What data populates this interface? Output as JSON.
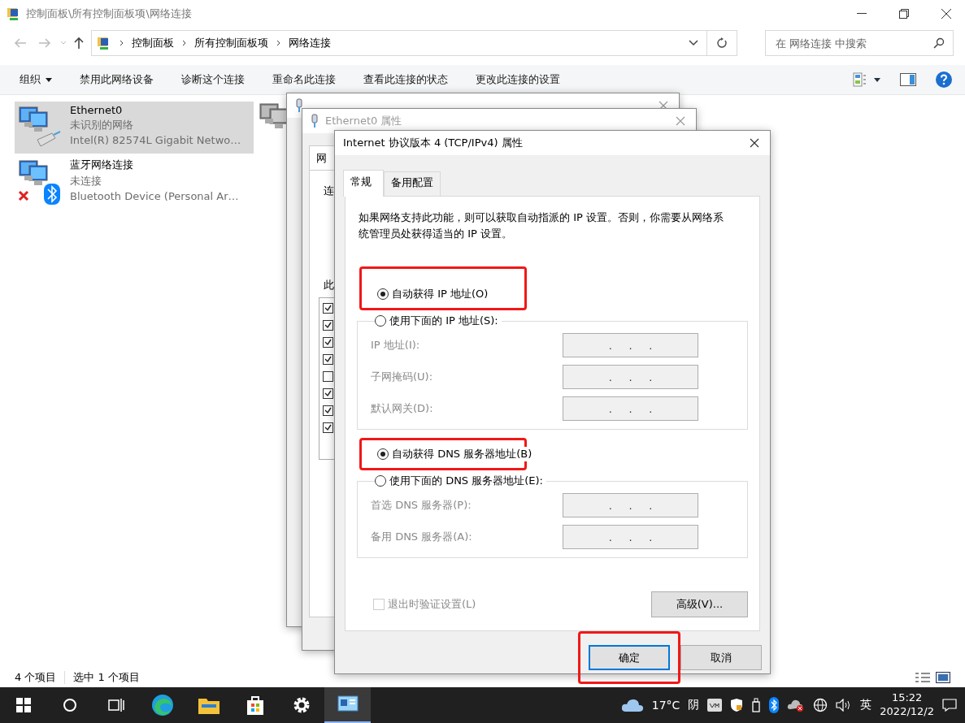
{
  "window": {
    "title": "控制面板\\所有控制面板项\\网络连接"
  },
  "address": {
    "crumbs": [
      "控制面板",
      "所有控制面板项",
      "网络连接"
    ]
  },
  "search": {
    "placeholder": "在 网络连接 中搜索"
  },
  "toolbar": {
    "items": [
      {
        "label": "组织",
        "kind": "menu"
      },
      {
        "label": "禁用此网络设备",
        "kind": "command"
      },
      {
        "label": "诊断这个连接",
        "kind": "command"
      },
      {
        "label": "重命名此连接",
        "kind": "command"
      },
      {
        "label": "查看此连接的状态",
        "kind": "command"
      },
      {
        "label": "更改此连接的设置",
        "kind": "command"
      }
    ]
  },
  "connections": [
    {
      "name": "Ethernet0",
      "status": "未识别的网络",
      "device": "Intel(R) 82574L Gigabit Netwo…",
      "selected": true,
      "kind": "ethernet"
    },
    {
      "name": "蓝牙网络连接",
      "status": "未连接",
      "device": "Bluetooth Device (Personal Ar…",
      "selected": false,
      "kind": "bluetooth"
    }
  ],
  "status_bar": {
    "count": "4 个项目",
    "selection": "选中 1 个项目"
  },
  "properties_dialog": {
    "title": "Ethernet0 属性",
    "tab": "网",
    "labels": [
      "连",
      "此"
    ],
    "components": [
      {
        "checked": true
      },
      {
        "checked": true
      },
      {
        "checked": true
      },
      {
        "checked": true
      },
      {
        "checked": false
      },
      {
        "checked": true
      },
      {
        "checked": true
      },
      {
        "checked": true
      }
    ]
  },
  "ipv4_dialog": {
    "title": "Internet 协议版本 4 (TCP/IPv4) 属性",
    "tabs": [
      {
        "label": "常规",
        "selected": true
      },
      {
        "label": "备用配置",
        "selected": false
      }
    ],
    "description": "如果网络支持此功能，则可以获取自动指派的 IP 设置。否则，你需要从网络系统管理员处获得适当的 IP 设置。",
    "ip_options": [
      {
        "label": "自动获得 IP 地址(O)",
        "selected": true,
        "highlighted": true
      },
      {
        "label": "使用下面的 IP 地址(S):",
        "selected": false,
        "highlighted": false
      }
    ],
    "ip_fields": [
      {
        "label": "IP 地址(I):",
        "value": ".     .     .",
        "disabled": true
      },
      {
        "label": "子网掩码(U):",
        "value": ".     .     .",
        "disabled": true
      },
      {
        "label": "默认网关(D):",
        "value": ".     .     .",
        "disabled": true
      }
    ],
    "dns_options": [
      {
        "label": "自动获得 DNS 服务器地址(B)",
        "selected": true,
        "highlighted": true
      },
      {
        "label": "使用下面的 DNS 服务器地址(E):",
        "selected": false,
        "highlighted": false
      }
    ],
    "dns_fields": [
      {
        "label": "首选 DNS 服务器(P):",
        "value": ".     .     .",
        "disabled": true
      },
      {
        "label": "备用 DNS 服务器(A):",
        "value": ".     .     .",
        "disabled": true
      }
    ],
    "validate": {
      "label": "退出时验证设置(L)",
      "checked": false,
      "disabled": true
    },
    "advanced_button": "高级(V)...",
    "buttons": [
      {
        "label": "确定",
        "default": true,
        "highlighted": true
      },
      {
        "label": "取消",
        "default": false,
        "highlighted": false
      }
    ]
  },
  "taskbar": {
    "temperature": "17°C",
    "weather": "阴",
    "ime": "英",
    "time": "15:22",
    "date": "2022/12/2"
  }
}
